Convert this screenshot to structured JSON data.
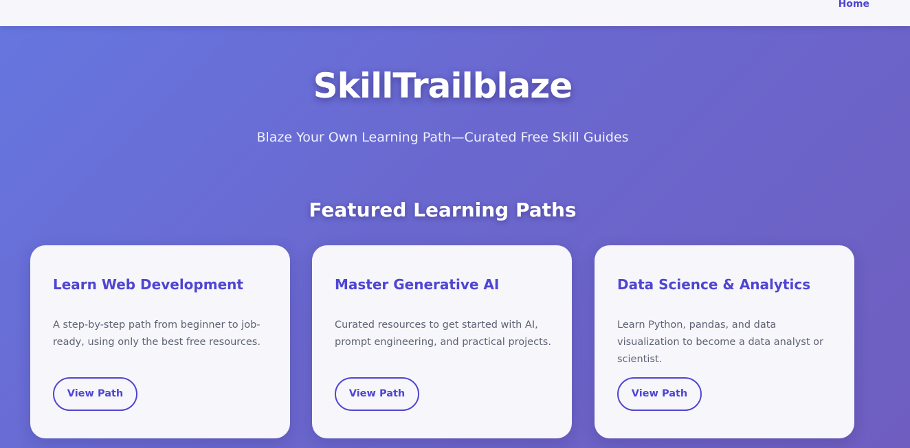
{
  "nav": {
    "home_label": "Home"
  },
  "hero": {
    "title": "SkillTrailblaze",
    "subtitle": "Blaze Your Own Learning Path—Curated Free Skill Guides"
  },
  "featured": {
    "heading": "Featured Learning Paths",
    "cards": [
      {
        "title": "Learn Web Development",
        "description": "A step-by-step path from beginner to job-ready, using only the best free resources.",
        "button_label": "View Path"
      },
      {
        "title": "Master Generative AI",
        "description": "Curated resources to get started with AI, prompt engineering, and practical projects.",
        "button_label": "View Path"
      },
      {
        "title": "Data Science & Analytics",
        "description": "Learn Python, pandas, and data visualization to become a data analyst or scientist.",
        "button_label": "View Path"
      }
    ]
  },
  "colors": {
    "accent": "#4f45d3",
    "background_gradient_start": "#6677e0",
    "background_gradient_end": "#6f5ec0",
    "card_background": "#f6f6fb"
  }
}
